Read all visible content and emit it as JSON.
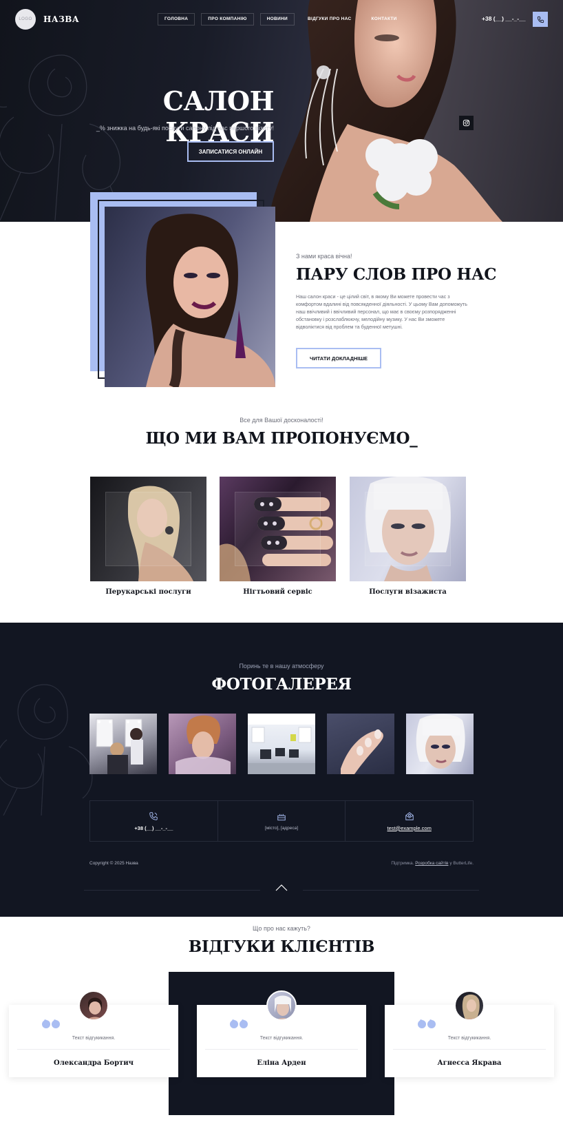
{
  "header": {
    "logo_text": "LOGO",
    "brand": "НАЗВА",
    "nav": [
      {
        "label": "ГОЛОВНА"
      },
      {
        "label": "ПРО КОМПАНІЮ"
      },
      {
        "label": "НОВИНИ"
      },
      {
        "label": "ВІДГУКИ ПРО НАС"
      },
      {
        "label": "КОНТАКТИ"
      }
    ],
    "phone": "+38 (__) __-_-__",
    "call_icon": "phone-icon"
  },
  "hero": {
    "title": "САЛОН КРАСИ",
    "subtitle": "_% знижка на будь-які послуги салону під час першого візиту!",
    "cta": "ЗАПИСАТИСЯ ОНЛАЙН",
    "social_icon": "instagram-icon"
  },
  "about": {
    "kicker": "З нами краса вічна!",
    "title": "ПАРУ СЛОВ ПРО НАС",
    "text": "Наш салон краси - це цілий світ, в якому Ви можете провести час з комфортом вдалині від повсякденної діяльності. У цьому Вам допоможуть наш ввічливий і ввічливий персонал, що має в своєму розпорядженні обстановку і розслаблюючу, мелодійну музику. У нас Ви зможете відволіктися від проблем та буденної метушні.",
    "button": "ЧИТАТИ ДОКЛАДНІШЕ"
  },
  "services": {
    "kicker": "Все для Вашої досконалості!",
    "title": "ЩО МИ ВАМ ПРОПОНУЄМО_",
    "items": [
      {
        "name": "Перукарські послуги"
      },
      {
        "name": "Нігтьовий сервіс"
      },
      {
        "name": "Послуги візажиста"
      }
    ]
  },
  "gallery": {
    "kicker": "Поринь те в нашу атмосферу",
    "title": "ФОТОГАЛЕРЕЯ"
  },
  "contacts": {
    "phone": "+38 (__) __-_-__",
    "address": "[місто], [адреса]",
    "email": "test@example.com",
    "icons": [
      "phone-icon",
      "map-icon",
      "mail-icon"
    ]
  },
  "footer": {
    "copyright": "Copyright © 2025 Назва",
    "support_prefix": "Підтримка.",
    "support_link": "Розробка сайтів",
    "support_suffix": "у ButterLife.",
    "up_icon": "chevron-up-icon"
  },
  "reviews": {
    "kicker": "Що про нас кажуть?",
    "title": "ВІДГУКИ КЛІЄНТІВ",
    "items": [
      {
        "text": "Текст відгукикання.",
        "name": "Олександра Бортич"
      },
      {
        "text": "Текст відгукикання.",
        "name": "Еліна Арден"
      },
      {
        "text": "Текст відгукикання.",
        "name": "Агнесса Якрава"
      }
    ]
  },
  "colors": {
    "accent": "#a9bdf2",
    "dark": "#121622"
  }
}
